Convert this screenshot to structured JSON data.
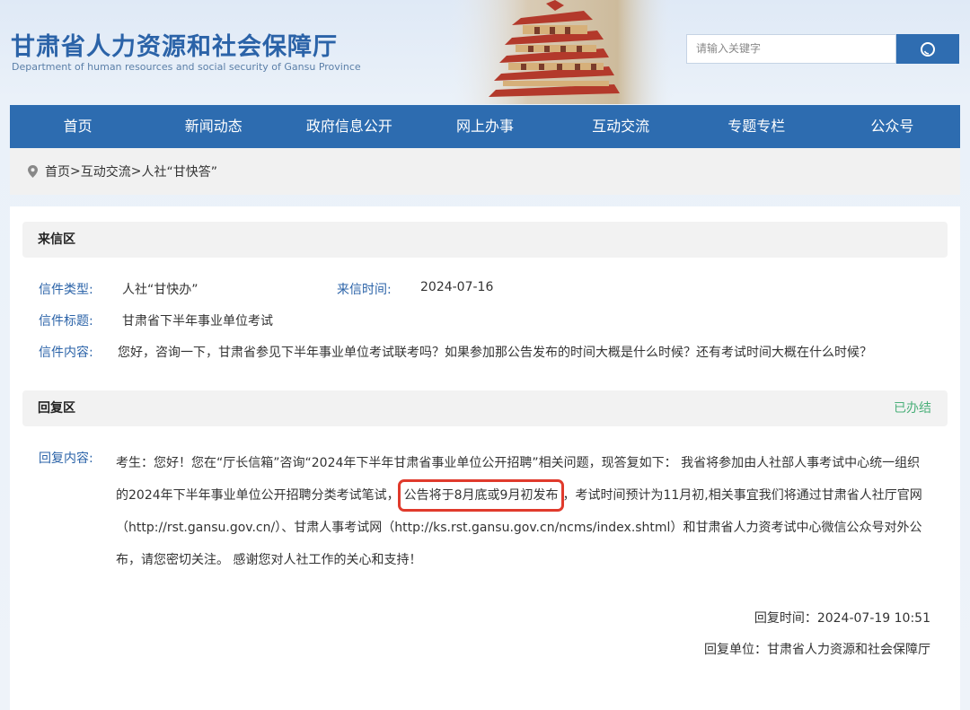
{
  "header": {
    "title": "甘肃省人力资源和社会保障厅",
    "subtitle": "Department of human resources and social security of Gansu Province",
    "search_placeholder": "请输入关键字"
  },
  "nav": {
    "items": [
      "首页",
      "新闻动态",
      "政府信息公开",
      "网上办事",
      "互动交流",
      "专题专栏",
      "公众号"
    ]
  },
  "breadcrumb": {
    "items": [
      "首页",
      ">",
      "互动交流",
      ">",
      "人社“甘快答”"
    ]
  },
  "letter": {
    "section_title": "来信区",
    "type_label": "信件类型:",
    "type_value": "人社“甘快办”",
    "time_label": "来信时间:",
    "time_value": "2024-07-16",
    "subject_label": "信件标题:",
    "subject_value": "甘肃省下半年事业单位考试",
    "content_label": "信件内容:",
    "content_value": "您好，咨询一下，甘肃省参见下半年事业单位考试联考吗？如果参加那公告发布的时间大概是什么时候？还有考试时间大概在什么时候？"
  },
  "reply": {
    "section_title": "回复区",
    "status": "已办结",
    "content_label": "回复内容:",
    "content_before": "考生：您好！您在“厅长信箱”咨询“2024年下半年甘肃省事业单位公开招聘”相关问题，现答复如下：  我省将参加由人社部人事考试中心统一组织的2024年下半年事业单位公开招聘分类考试笔试，",
    "content_highlight": "公告将于8月底或9月初发布",
    "content_after": "，考试时间预计为11月初,相关事宜我们将通过甘肃省人社厅官网（http://rst.gansu.gov.cn/）、甘肃人事考试网（http://ks.rst.gansu.gov.cn/ncms/index.shtml）和甘肃省人力资考试中心微信公众号对外公布，请您密切关注。 感谢您对人社工作的关心和支持！",
    "time": "回复时间：2024-07-19 10:51",
    "unit": "回复单位：甘肃省人力资源和社会保障厅"
  }
}
